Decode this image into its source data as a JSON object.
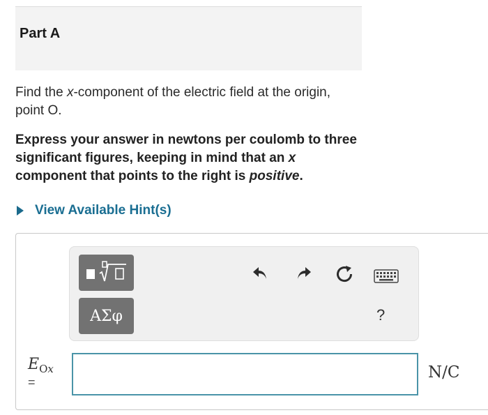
{
  "part": {
    "title": "Part A"
  },
  "question": {
    "prefix": "Find the ",
    "var": "x",
    "suffix": "-component of the electric field at the origin, point O."
  },
  "instructions": {
    "line1": "Express your answer in newtons per coulomb to three significant figures, keeping in mind that an ",
    "var": "x",
    "line2": " component that points to the right is ",
    "emphasis": "positive",
    "end": "."
  },
  "hint": {
    "label": "View Available Hint(s)"
  },
  "toolbar": {
    "symbols_label": "ΑΣφ",
    "help_label": "?",
    "icons": [
      "templates-icon",
      "undo-icon",
      "redo-icon",
      "reset-icon",
      "keyboard-icon"
    ]
  },
  "answer": {
    "var_main": "E",
    "var_sub_upright": "O",
    "var_sub_italic": "x",
    "equals": "=",
    "value": "",
    "units": "N/C"
  },
  "colors": {
    "link": "#1a6e92",
    "input_border": "#4a94a8",
    "tool_button": "#727272"
  }
}
